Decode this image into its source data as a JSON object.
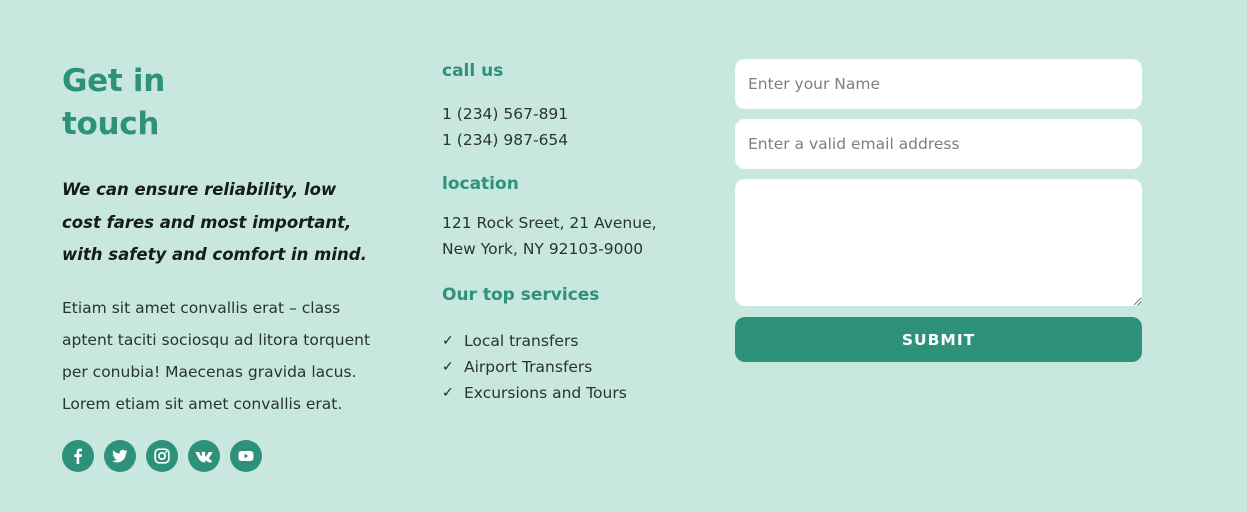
{
  "contact": {
    "title_line1": "Get in",
    "title_line2": "touch",
    "tagline": "We can ensure reliability, low cost fares and most important, with safety and comfort in mind.",
    "body": "Etiam sit amet convallis erat – class aptent taciti sociosqu ad litora torquent per conubia! Maecenas gravida lacus. Lorem etiam sit amet convallis erat.",
    "social": [
      "facebook-icon",
      "twitter-icon",
      "instagram-icon",
      "vk-icon",
      "youtube-icon"
    ]
  },
  "call_us": {
    "heading": "call us",
    "phones": [
      "1 (234) 567-891",
      "1 (234) 987-654"
    ]
  },
  "location": {
    "heading": "location",
    "lines": [
      "121 Rock Sreet, 21 Avenue,",
      "New York, NY 92103-9000"
    ]
  },
  "services": {
    "heading": "Our top services",
    "check_icon": "✓",
    "items": [
      "Local transfers",
      "Airport Transfers",
      "Excursions and Tours"
    ]
  },
  "form": {
    "name_placeholder": "Enter your Name",
    "email_placeholder": "Enter a valid email address",
    "message_value": "",
    "submit_label": "SUBMIT"
  },
  "colors": {
    "background": "#c8e8df",
    "accent": "#2e917a",
    "field_bg": "#ffffff"
  }
}
